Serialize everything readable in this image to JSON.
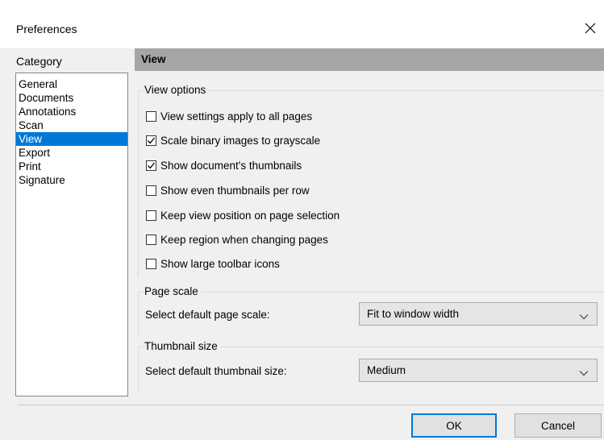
{
  "window": {
    "title": "Preferences",
    "close_icon": "close-icon"
  },
  "sidebar": {
    "label": "Category",
    "items": [
      {
        "label": "General",
        "selected": false
      },
      {
        "label": "Documents",
        "selected": false
      },
      {
        "label": "Annotations",
        "selected": false
      },
      {
        "label": "Scan",
        "selected": false
      },
      {
        "label": "View",
        "selected": true
      },
      {
        "label": "Export",
        "selected": false
      },
      {
        "label": "Print",
        "selected": false
      },
      {
        "label": "Signature",
        "selected": false
      }
    ]
  },
  "panel": {
    "title": "View",
    "view_options": {
      "label": "View options",
      "checkboxes": [
        {
          "label": "View settings apply to all pages",
          "checked": false
        },
        {
          "label": "Scale binary images to grayscale",
          "checked": true
        },
        {
          "label": "Show document's thumbnails",
          "checked": true
        },
        {
          "label": "Show even thumbnails per row",
          "checked": false
        },
        {
          "label": "Keep view position on page selection",
          "checked": false
        },
        {
          "label": "Keep region when changing pages",
          "checked": false
        },
        {
          "label": "Show large toolbar icons",
          "checked": false
        }
      ]
    },
    "page_scale": {
      "label": "Page scale",
      "field_label": "Select default page scale:",
      "value": "Fit to window width"
    },
    "thumbnail_size": {
      "label": "Thumbnail size",
      "field_label": "Select default thumbnail size:",
      "value": "Medium"
    }
  },
  "buttons": {
    "ok": "OK",
    "cancel": "Cancel"
  },
  "colors": {
    "selection": "#0078d7",
    "header_bg": "#a5a5a5",
    "dialog_bg": "#f0f0f0"
  }
}
